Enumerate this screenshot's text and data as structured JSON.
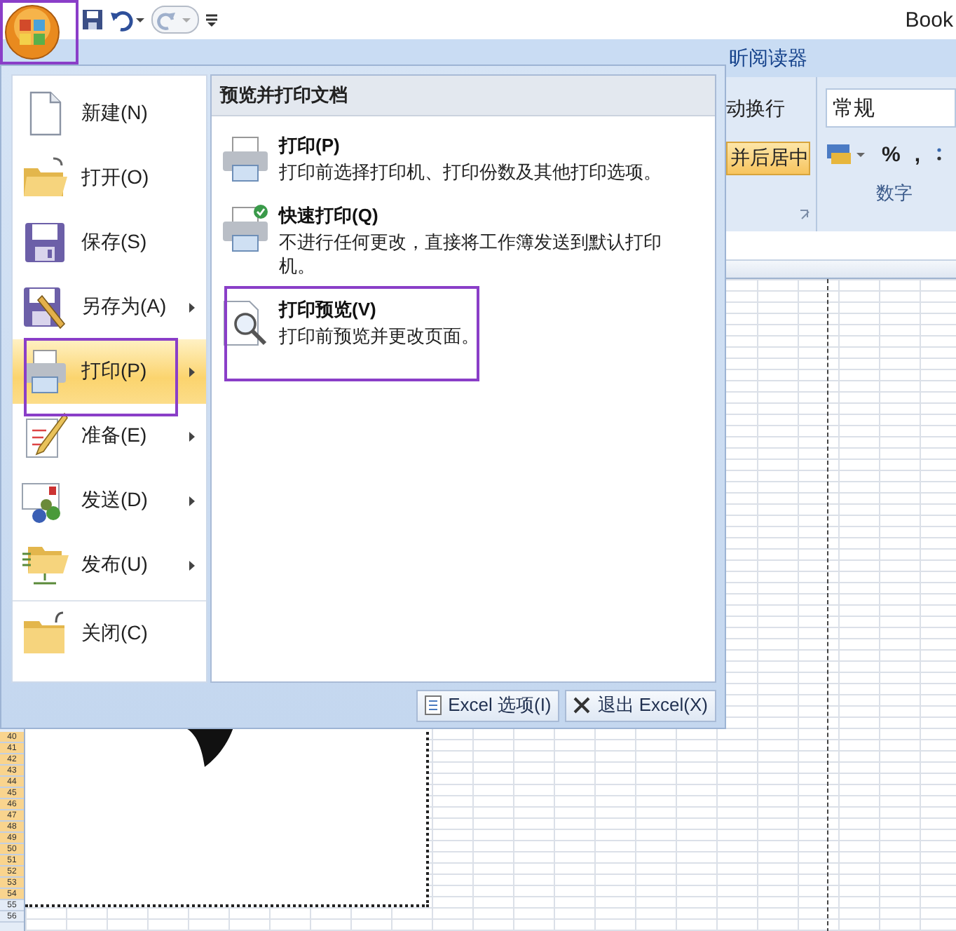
{
  "office_button": {
    "annotated": true
  },
  "window": {
    "title": "Book"
  },
  "ribbon": {
    "tabs": [
      {
        "label": "昕阅读器",
        "selected": false
      }
    ],
    "alignment": {
      "wrap_text": "动换行",
      "merge_center": "并后居中"
    },
    "number": {
      "format": "常规",
      "percent": "%",
      "comma": ",",
      "group_label": "数字"
    }
  },
  "file_menu": {
    "items": [
      {
        "label": "新建(N)",
        "has_submenu": false,
        "selected": false,
        "annotated": false
      },
      {
        "label": "打开(O)",
        "has_submenu": false,
        "selected": false,
        "annotated": false
      },
      {
        "label": "保存(S)",
        "has_submenu": false,
        "selected": false,
        "annotated": false
      },
      {
        "label": "另存为(A)",
        "has_submenu": true,
        "selected": false,
        "annotated": false
      },
      {
        "label": "打印(P)",
        "has_submenu": true,
        "selected": true,
        "annotated": true
      },
      {
        "label": "准备(E)",
        "has_submenu": true,
        "selected": false,
        "annotated": false
      },
      {
        "label": "发送(D)",
        "has_submenu": true,
        "selected": false,
        "annotated": false
      },
      {
        "label": "发布(U)",
        "has_submenu": true,
        "selected": false,
        "annotated": false
      },
      {
        "label": "关闭(C)",
        "has_submenu": false,
        "selected": false,
        "annotated": false
      }
    ],
    "panel": {
      "title": "预览并打印文档",
      "entries": [
        {
          "title": "打印(P)",
          "description": "打印前选择打印机、打印份数及其他打印选项。",
          "annotated": false
        },
        {
          "title": "快速打印(Q)",
          "description": "不进行任何更改，直接将工作簿发送到默认打印机。",
          "annotated": false
        },
        {
          "title": "打印预览(V)",
          "description": "打印前预览并更改页面。",
          "annotated": true
        }
      ]
    },
    "buttons": [
      {
        "label": "Excel 选项(I)"
      },
      {
        "label": "退出 Excel(X)"
      }
    ]
  },
  "sheet": {
    "row_numbers": [
      {
        "label": "40",
        "selected": true
      },
      {
        "label": "41",
        "selected": true
      },
      {
        "label": "42",
        "selected": true
      },
      {
        "label": "43",
        "selected": true
      },
      {
        "label": "44",
        "selected": true
      },
      {
        "label": "45",
        "selected": true
      },
      {
        "label": "46",
        "selected": true
      },
      {
        "label": "47",
        "selected": true
      },
      {
        "label": "48",
        "selected": true
      },
      {
        "label": "49",
        "selected": true
      },
      {
        "label": "50",
        "selected": true
      },
      {
        "label": "51",
        "selected": true
      },
      {
        "label": "52",
        "selected": true
      },
      {
        "label": "53",
        "selected": true
      },
      {
        "label": "54",
        "selected": true
      },
      {
        "label": "55",
        "selected": false
      },
      {
        "label": "56",
        "selected": false
      }
    ]
  }
}
